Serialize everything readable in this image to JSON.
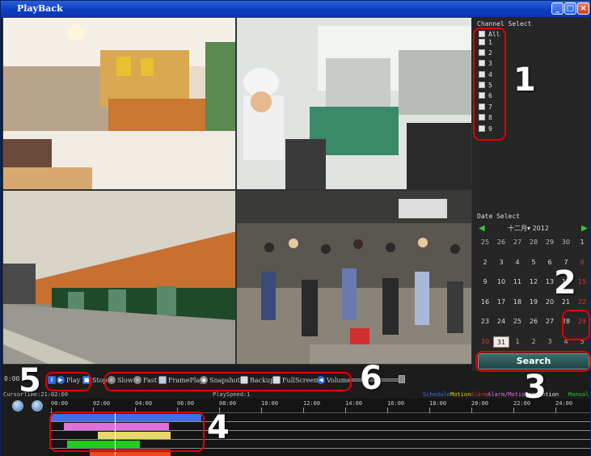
{
  "window": {
    "title": "PlayBack"
  },
  "channel_select": {
    "title": "Channel Select",
    "items": [
      "All",
      "1",
      "2",
      "3",
      "4",
      "5",
      "6",
      "7",
      "8",
      "9"
    ]
  },
  "date_select": {
    "title": "Date Select",
    "month_label": "十二月",
    "year": "2012",
    "days": [
      [
        "25",
        "26",
        "27",
        "28",
        "29",
        "30",
        "1"
      ],
      [
        "2",
        "3",
        "4",
        "5",
        "6",
        "7",
        "8"
      ],
      [
        "9",
        "10",
        "11",
        "12",
        "13",
        "14",
        "15"
      ],
      [
        "16",
        "17",
        "18",
        "19",
        "20",
        "21",
        "22"
      ],
      [
        "23",
        "24",
        "25",
        "26",
        "27",
        "28",
        "29"
      ],
      [
        "30",
        "31",
        "1",
        "2",
        "3",
        "4",
        "5"
      ]
    ],
    "selected_day": "31"
  },
  "search_label": "Search",
  "controls": {
    "time": "0:00",
    "play": "Play",
    "stop": "Stop",
    "slow": "Slow",
    "fast": "Fast",
    "frameplay": "FramePlay",
    "snapshot": "Snapshot",
    "backup": "Backup",
    "fullscreen": "FullScreen",
    "volume": "Volume"
  },
  "timeline": {
    "cursor_time": "CursorTime:21:02:00",
    "play_speed": "PlaySpeed:1",
    "legend": [
      {
        "label": "Schedule",
        "color": "#3f6fe8"
      },
      {
        "label": "Motion",
        "color": "#e8d020"
      },
      {
        "label": "Alarm",
        "color": "#e03020"
      },
      {
        "label": "Alarm/Motion",
        "color": "#e070e0"
      },
      {
        "label": "CardMotion",
        "color": "#e8e8e8"
      },
      {
        "label": "Manual",
        "color": "#20cc20"
      }
    ],
    "ticks": [
      "00:00",
      "02:00",
      "04:00",
      "06:00",
      "08:00",
      "10:00",
      "12:00",
      "14:00",
      "16:00",
      "18:00",
      "20:00",
      "22:00",
      "24:00"
    ]
  },
  "annotations": [
    "1",
    "2",
    "3",
    "4",
    "5",
    "6"
  ]
}
